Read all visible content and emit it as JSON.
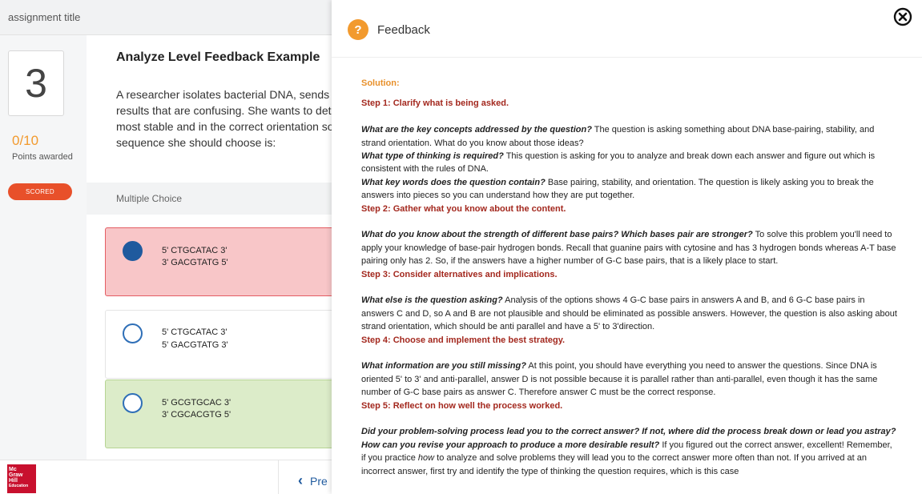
{
  "assignment_title": "assignment title",
  "question": {
    "number": "3",
    "points_value": "0/10",
    "points_label": "Points awarded",
    "scored_badge": "SCORED",
    "title": "Analyze Level Feedback Example",
    "text_lines": [
      "A researcher isolates bacterial DNA, sends it",
      "results that are confusing. She wants to dete",
      "most stable and in the correct orientation so",
      "sequence she should choose is:"
    ],
    "type_label": "Multiple Choice",
    "options": [
      {
        "line1": "5' CTGCATAC 3'",
        "line2": "3' GACGTATG 5'",
        "state": "incorrect-selected"
      },
      {
        "line1": "5' CTGCATAC 3'",
        "line2": "5' GACGTATG 3'",
        "state": "unselected"
      },
      {
        "line1": "5' GCGTGCAC 3'",
        "line2": "3' CGCACGTG 5'",
        "state": "correct"
      }
    ]
  },
  "nav": {
    "prev_label": "Pre"
  },
  "logo_lines": [
    "Mc",
    "Graw",
    "Hill",
    "Education"
  ],
  "panel": {
    "title": "Feedback",
    "help_icon": "question-mark-icon",
    "close_icon": "close-circle-icon"
  },
  "feedback": {
    "solution_label": "Solution:",
    "steps": [
      "Step 1: Clarify what is being asked.",
      "Step 2: Gather what you know about the content.",
      "Step 3: Consider alternatives and implications.",
      "Step 4: Choose and implement the best strategy.",
      "Step 5: Reflect on how well the process worked."
    ],
    "paragraphs": [
      {
        "q": "What are the key concepts addressed by the question?",
        "t": " The question is asking something about DNA base-pairing, stability, and strand orientation. What do you know about those ideas?"
      },
      {
        "q": "What type of thinking is required?",
        "t": " This question is asking for you to analyze and break down each answer and figure out which is consistent with the rules of DNA."
      },
      {
        "q": "What key words does the question contain?",
        "t": " Base pairing, stability, and orientation. The question is likely asking you to break the answers into pieces so you can understand how they are put together."
      },
      {
        "q": "What do you know about the strength of different base pairs? Which bases pair are stronger?",
        "t": " To solve this problem you'll need to apply your knowledge of base-pair hydrogen bonds. Recall that guanine pairs with cytosine and has 3 hydrogen bonds whereas A-T base pairing only has 2. So, if the answers have a higher number of G-C base pairs, that is a likely place to start."
      },
      {
        "q": "What else is the question asking?",
        "t": " Analysis of the options shows 4 G-C base pairs in answers A and B, and 6 G-C base pairs in answers C and D, so A and B are not plausible and should be eliminated as possible answers. However, the question is also asking about strand orientation, which should be anti parallel and have a 5' to 3'direction."
      },
      {
        "q": "What information are you still missing?",
        "t": " At this point, you should have everything you need to answer the questions. Since DNA is oriented 5' to 3' and anti-parallel, answer D is not possible because it is parallel rather than anti-parallel, even though it has the same number of G-C base pairs as answer C. Therefore answer C must be the correct response."
      },
      {
        "q": "Did your problem-solving process lead you to the correct answer? If not, where did the process break down or lead you astray? How can you revise your approach to produce a more desirable result?",
        "t1": " If you figured out the correct answer, excellent! Remember, if you practice ",
        "em": "how",
        "t2": " to analyze and solve problems they will lead you to the correct answer more often than not. If you arrived at an incorrect answer, first try and identify the type of thinking the question requires, which is this case"
      }
    ]
  },
  "colors": {
    "accent_orange": "#f29a2e",
    "step_red": "#a3281e",
    "scored_badge": "#e8502a",
    "incorrect_bg": "#f8c6c8",
    "correct_bg": "#dcecc9",
    "radio_blue": "#1f5a9e"
  }
}
